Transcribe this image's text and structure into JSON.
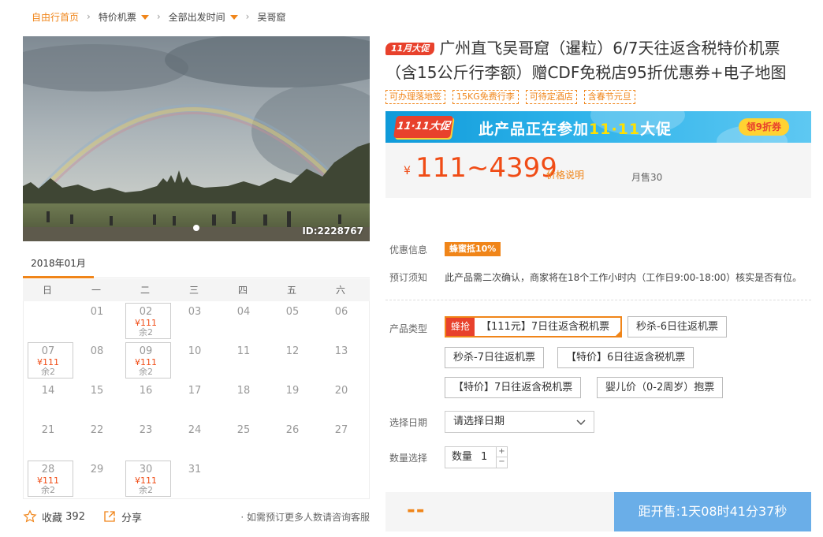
{
  "breadcrumb": {
    "home": "自由行首页",
    "items": [
      "特价机票",
      "全部出发时间",
      "吴哥窟"
    ]
  },
  "photo": {
    "id_label": "ID:2228767",
    "alt": ""
  },
  "calendar": {
    "month": "2018年01月",
    "weekdays": [
      "日",
      "一",
      "二",
      "三",
      "四",
      "五",
      "六"
    ],
    "cells": [
      {
        "day": "",
        "price": "",
        "remain": ""
      },
      {
        "day": "01",
        "price": "",
        "remain": ""
      },
      {
        "day": "02",
        "price": "¥111",
        "remain": "余2"
      },
      {
        "day": "03",
        "price": "",
        "remain": ""
      },
      {
        "day": "04",
        "price": "",
        "remain": ""
      },
      {
        "day": "05",
        "price": "",
        "remain": ""
      },
      {
        "day": "06",
        "price": "",
        "remain": ""
      },
      {
        "day": "07",
        "price": "¥111",
        "remain": "余2"
      },
      {
        "day": "08",
        "price": "",
        "remain": ""
      },
      {
        "day": "09",
        "price": "¥111",
        "remain": "余2"
      },
      {
        "day": "10",
        "price": "",
        "remain": ""
      },
      {
        "day": "11",
        "price": "",
        "remain": ""
      },
      {
        "day": "12",
        "price": "",
        "remain": ""
      },
      {
        "day": "13",
        "price": "",
        "remain": ""
      },
      {
        "day": "14",
        "price": "",
        "remain": ""
      },
      {
        "day": "15",
        "price": "",
        "remain": ""
      },
      {
        "day": "16",
        "price": "",
        "remain": ""
      },
      {
        "day": "17",
        "price": "",
        "remain": ""
      },
      {
        "day": "18",
        "price": "",
        "remain": ""
      },
      {
        "day": "19",
        "price": "",
        "remain": ""
      },
      {
        "day": "20",
        "price": "",
        "remain": ""
      },
      {
        "day": "21",
        "price": "",
        "remain": ""
      },
      {
        "day": "22",
        "price": "",
        "remain": ""
      },
      {
        "day": "23",
        "price": "",
        "remain": ""
      },
      {
        "day": "24",
        "price": "",
        "remain": ""
      },
      {
        "day": "25",
        "price": "",
        "remain": ""
      },
      {
        "day": "26",
        "price": "",
        "remain": ""
      },
      {
        "day": "27",
        "price": "",
        "remain": ""
      },
      {
        "day": "28",
        "price": "¥111",
        "remain": "余2"
      },
      {
        "day": "29",
        "price": "",
        "remain": ""
      },
      {
        "day": "30",
        "price": "¥111",
        "remain": "余2"
      },
      {
        "day": "31",
        "price": "",
        "remain": ""
      },
      {
        "day": "",
        "price": "",
        "remain": ""
      },
      {
        "day": "",
        "price": "",
        "remain": ""
      },
      {
        "day": "",
        "price": "",
        "remain": ""
      }
    ]
  },
  "actions": {
    "favorite_label": "收藏",
    "favorite_count": "392",
    "share_label": "分享",
    "hint": "· 如需预订更多人数请咨询客服"
  },
  "product": {
    "badge": "11月大促",
    "title": "广州直飞吴哥窟（暹粒）6/7天往返含税特价机票（含15公斤行李额）赠CDF免税店95折优惠券+电子地图",
    "tags": [
      "可办理落地签",
      "15KG免费行李",
      "可待定酒店",
      "含春节元旦"
    ]
  },
  "promo": {
    "badge": "11·11大促",
    "text_prefix": "此产品正在参加",
    "text_highlight": "11·11",
    "text_suffix": "大促",
    "button": "领9折券"
  },
  "price": {
    "currency": "¥",
    "range": "111~4399",
    "note": "价格说明",
    "sold": "月售30"
  },
  "info": {
    "discount_label": "优惠信息",
    "discount_value": "蜂蜜抵10%",
    "notice_label": "预订须知",
    "notice_value": "此产品需二次确认，商家将在18个工作小时内（工作日9:00-18:00）核实是否有位。"
  },
  "options": {
    "label": "产品类型",
    "selected_tag": "蜂抢",
    "items": [
      "【111元】7日往返含税机票",
      "秒杀-6日往返机票",
      "秒杀-7日往返机票",
      "【特价】6日往返含税机票",
      "【特价】7日往返含税机票",
      "婴儿价（0-2周岁）抱票"
    ]
  },
  "date_select": {
    "label": "选择日期",
    "placeholder": "请选择日期"
  },
  "quantity": {
    "label": "数量选择",
    "unit": "数量",
    "value": "1",
    "plus": "+",
    "minus": "−"
  },
  "buy": {
    "placeholder_price": "--",
    "countdown": "距开售:1天08时41分37秒"
  },
  "colors": {
    "accent": "#f08519",
    "price": "#f04c16",
    "badge_red": "#e8412c",
    "countdown_bg": "#6aaee8",
    "promo_blue": "#0f9ad9"
  }
}
